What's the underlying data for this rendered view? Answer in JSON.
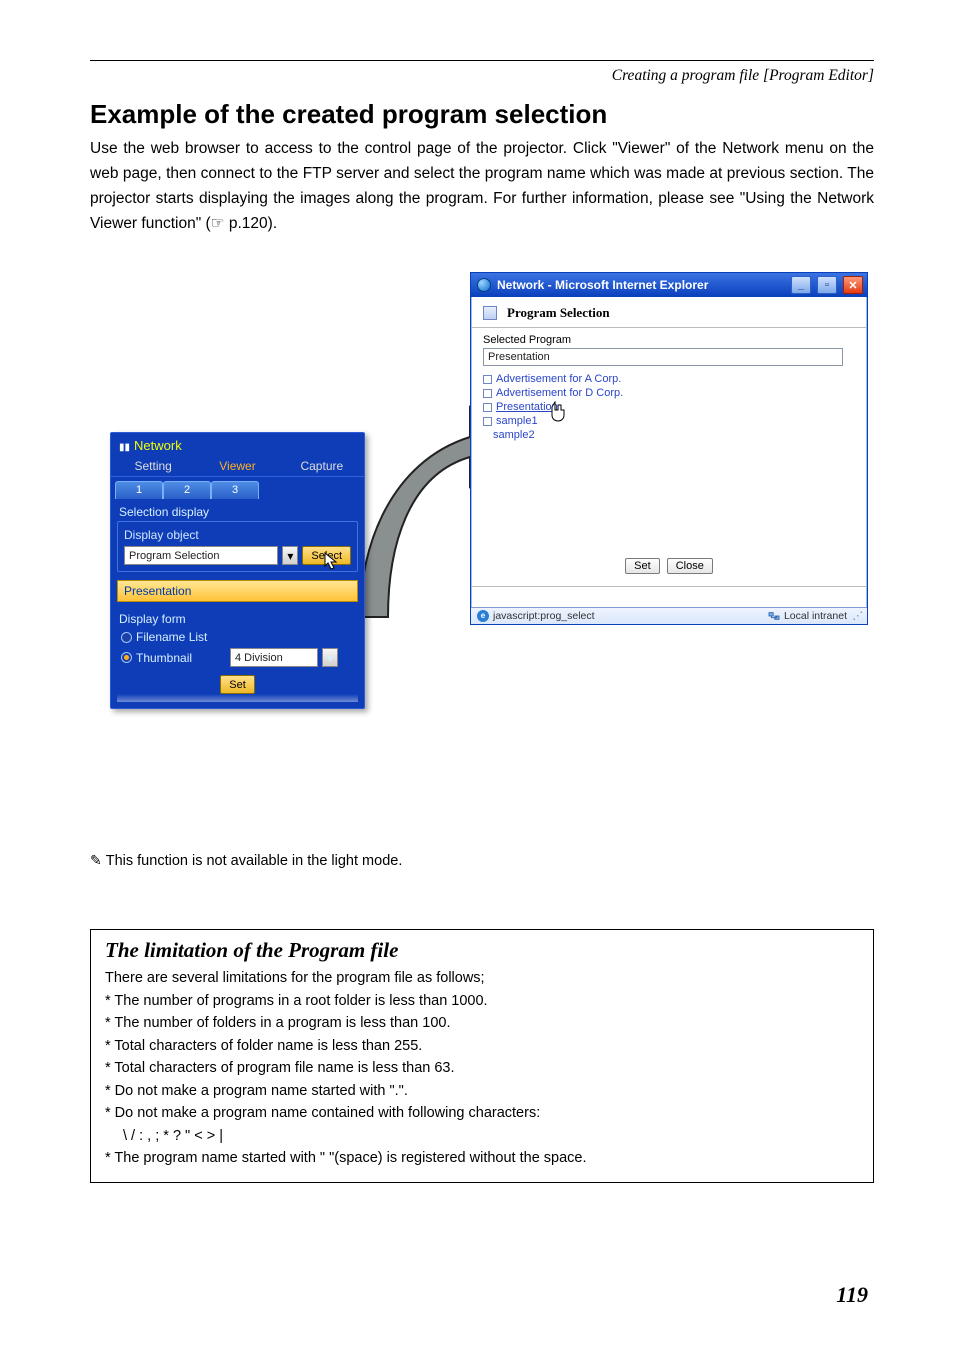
{
  "header": {
    "breadcrumb": "Creating a program file [Program Editor]"
  },
  "title": "Example of the created program selection",
  "intro": "Use the web browser to access to the control page of the projector. Click \"Viewer\" of the Network menu on the web page, then connect to the FTP server and select the program name which was made at previous section. The projector starts displaying the images along the program. For further information, please see \"Using the Network Viewer function\" (☞ p.120).",
  "net_panel": {
    "title": "Network",
    "tabs": {
      "setting": "Setting",
      "viewer": "Viewer",
      "capture": "Capture"
    },
    "sub_tabs": [
      "1",
      "2",
      "3"
    ],
    "selection_display": "Selection display",
    "display_object": "Display object",
    "program_selection_label": "Program Selection",
    "select_btn": "Select",
    "presentation": "Presentation",
    "display_form": "Display form",
    "filename_list": "Filename List",
    "thumbnail": "Thumbnail",
    "division_value": "4 Division",
    "set_btn": "Set"
  },
  "ie_win": {
    "title": "Network - Microsoft Internet Explorer",
    "section_title": "Program Selection",
    "selected_program_label": "Selected Program",
    "selected_program_value": "Presentation",
    "programs": [
      {
        "label": "Advertisement for A Corp.",
        "link": false
      },
      {
        "label": "Advertisement for D Corp.",
        "link": false
      },
      {
        "label": "Presentation",
        "link": true
      },
      {
        "label": "sample1",
        "link": false
      },
      {
        "label": "sample2",
        "link": false
      }
    ],
    "set_btn": "Set",
    "close_btn": "Close",
    "status_left": "javascript:prog_select",
    "status_right": "Local intranet"
  },
  "note": "This function is not available in the light mode.",
  "limitation": {
    "title": "The limitation of the Program file",
    "intro": "There are several limitations for the program file as follows;",
    "l1": "* The number of programs in a root folder is less than 1000.",
    "l2": "* The number of folders in a program is less than 100.",
    "l3": "* Total characters of folder name is less than 255.",
    "l4": "* Total characters of program file name is less than 63.",
    "l5": "* Do not make a program name started with \".\".",
    "l6": "* Do not make a program name contained with following characters:",
    "l6b": "\\ / : , ; * ? \" < > |",
    "l7": "* The program name started with \" \"(space) is registered without the space."
  },
  "page_number": "119"
}
